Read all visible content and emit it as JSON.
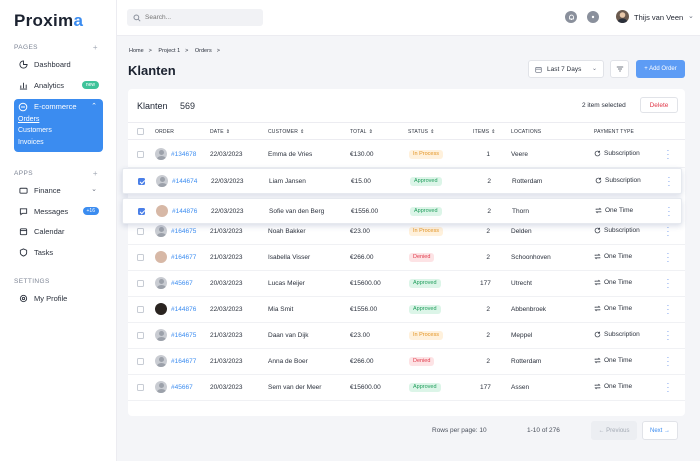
{
  "app": {
    "logo_main": "Proxim",
    "logo_accent": "a"
  },
  "sidebar": {
    "pages_label": "PAGES",
    "apps_label": "APPS",
    "settings_label": "SETTINGS",
    "dashboard": "Dashboard",
    "analytics": "Analytics",
    "analytics_badge": "new",
    "ecommerce": "E-commerce",
    "orders": "Orders",
    "customers": "Customers",
    "invoices": "Invoices",
    "finance": "Finance",
    "messages": "Messages",
    "messages_badge": "+16",
    "calendar": "Calendar",
    "tasks": "Tasks",
    "profile": "My Profile"
  },
  "topbar": {
    "search_placeholder": "Search...",
    "user_name": "Thijs van Veen"
  },
  "breadcrumb": [
    "Home",
    "Project 1",
    "Orders"
  ],
  "page_title": "Klanten",
  "filter": {
    "range": "Last 7 Days",
    "add_label": "+ Add Order"
  },
  "table": {
    "title": "Klanten",
    "count": "569",
    "selected_info": "2 item selected",
    "delete_label": "Delete",
    "headers": {
      "order": "ORDER",
      "date": "DATE",
      "customer": "CUSTOMER",
      "total": "TOTAL",
      "status": "STATUS",
      "items": "ITEMS",
      "locations": "LOCATIONS",
      "payment": "PAYMENT TYPE"
    },
    "rows": [
      {
        "order": "#134678",
        "date": "22/03/2023",
        "customer": "Emma de Vries",
        "total": "€130.00",
        "status": "In Process",
        "items": "1",
        "location": "Veere",
        "payment": "Subscription"
      },
      {
        "order": "#144674",
        "date": "22/03/2023",
        "customer": "Liam Jansen",
        "total": "€15.00",
        "status": "Approved",
        "items": "2",
        "location": "Rotterdam",
        "payment": "Subscription"
      },
      {
        "order": "#144876",
        "date": "22/03/2023",
        "customer": "Sofie van den Berg",
        "total": "€1556.00",
        "status": "Approved",
        "items": "2",
        "location": "Thorn",
        "payment": "One Time"
      },
      {
        "order": "#164675",
        "date": "21/03/2023",
        "customer": "Noah Bakker",
        "total": "€23.00",
        "status": "In Process",
        "items": "2",
        "location": "Delden",
        "payment": "Subscription"
      },
      {
        "order": "#164677",
        "date": "21/03/2023",
        "customer": "Isabella Visser",
        "total": "€266.00",
        "status": "Denied",
        "items": "2",
        "location": "Schoonhoven",
        "payment": "One Time"
      },
      {
        "order": "#45667",
        "date": "20/03/2023",
        "customer": "Lucas Meijer",
        "total": "€15600.00",
        "status": "Approved",
        "items": "177",
        "location": "Utrecht",
        "payment": "One Time"
      },
      {
        "order": "#144876",
        "date": "22/03/2023",
        "customer": "Mia Smit",
        "total": "€1556.00",
        "status": "Approved",
        "items": "2",
        "location": "Abbenbroek",
        "payment": "One Time"
      },
      {
        "order": "#164675",
        "date": "21/03/2023",
        "customer": "Daan van Dijk",
        "total": "€23.00",
        "status": "In Process",
        "items": "2",
        "location": "Meppel",
        "payment": "Subscription"
      },
      {
        "order": "#164677",
        "date": "21/03/2023",
        "customer": "Anna de Boer",
        "total": "€266.00",
        "status": "Denied",
        "items": "2",
        "location": "Rotterdam",
        "payment": "One Time"
      },
      {
        "order": "#45667",
        "date": "20/03/2023",
        "customer": "Sem van der Meer",
        "total": "€15600.00",
        "status": "Approved",
        "items": "177",
        "location": "Assen",
        "payment": "One Time"
      }
    ]
  },
  "pagination": {
    "rows_per_page": "Rows per page: 10",
    "range": "1-10 of 276",
    "prev": "← Previous",
    "next": "Next →"
  },
  "colors": {
    "accent": "#3b8cf0",
    "approved": "#1f9d5b",
    "in_process": "#e39422",
    "denied": "#e0394a"
  }
}
